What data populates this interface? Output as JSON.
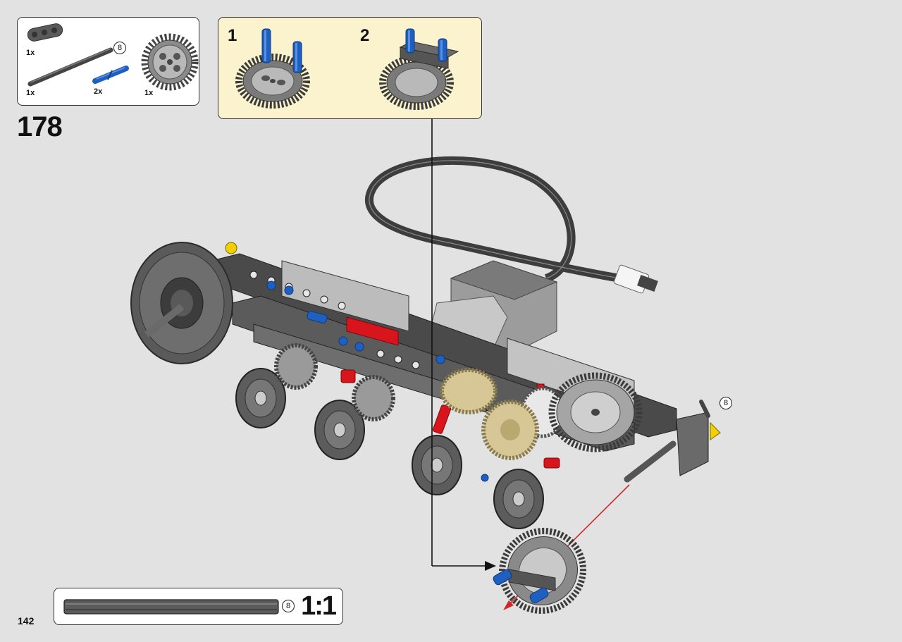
{
  "parts_list": {
    "items": [
      {
        "name": "beam-3",
        "quantity": "1x"
      },
      {
        "name": "axle-8",
        "quantity": "1x",
        "length": "8"
      },
      {
        "name": "axle-pin-blue",
        "quantity": "2x"
      },
      {
        "name": "gear-36-tooth",
        "quantity": "1x"
      }
    ]
  },
  "step": {
    "number": "178"
  },
  "subassembly": {
    "steps": [
      {
        "number": "1"
      },
      {
        "number": "2"
      }
    ]
  },
  "callouts": {
    "axle_length": "8"
  },
  "scale": {
    "axle_length": "8",
    "label": "1:1"
  },
  "page": {
    "number": "142"
  },
  "colors": {
    "background": "#e2e2e2",
    "subassembly_bg": "#fbf3cd",
    "pin_blue": "#1f5fbf",
    "connector_red": "#d8141c",
    "gear_tan": "#d8c796",
    "part_dark": "#555555",
    "arrow_red": "#d0262b"
  }
}
